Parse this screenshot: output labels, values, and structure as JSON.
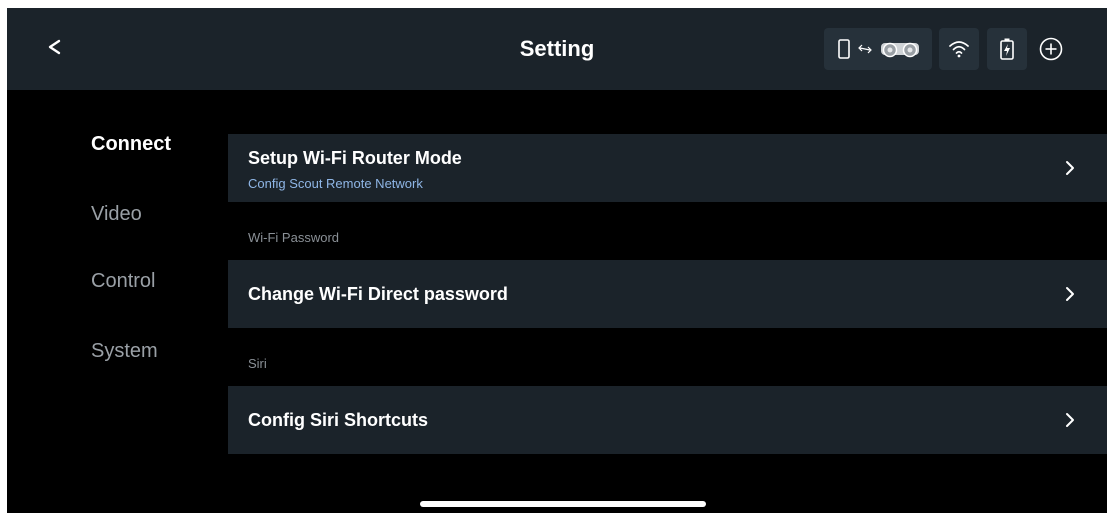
{
  "header": {
    "title": "Setting",
    "back_label": "<"
  },
  "status": {
    "device_icon": "phone-to-rover-icon",
    "wifi_icon": "wifi-icon",
    "battery_icon": "battery-charging-icon",
    "add_icon": "plus-circle-icon"
  },
  "sidebar": {
    "items": [
      {
        "label": "Connect",
        "active": true
      },
      {
        "label": "Video",
        "active": false
      },
      {
        "label": "Control",
        "active": false
      },
      {
        "label": "System",
        "active": false
      }
    ]
  },
  "content": {
    "router_mode": {
      "title": "Setup Wi-Fi Router Mode",
      "subtitle": "Config Scout Remote Network"
    },
    "wifi_password_section": "Wi-Fi Password",
    "change_password": {
      "title": "Change Wi-Fi Direct password"
    },
    "siri_section": "Siri",
    "siri_shortcuts": {
      "title": "Config Siri Shortcuts"
    }
  },
  "colors": {
    "background": "#000000",
    "panel": "#1b232a",
    "subtitle_accent": "#8fb6e6"
  }
}
